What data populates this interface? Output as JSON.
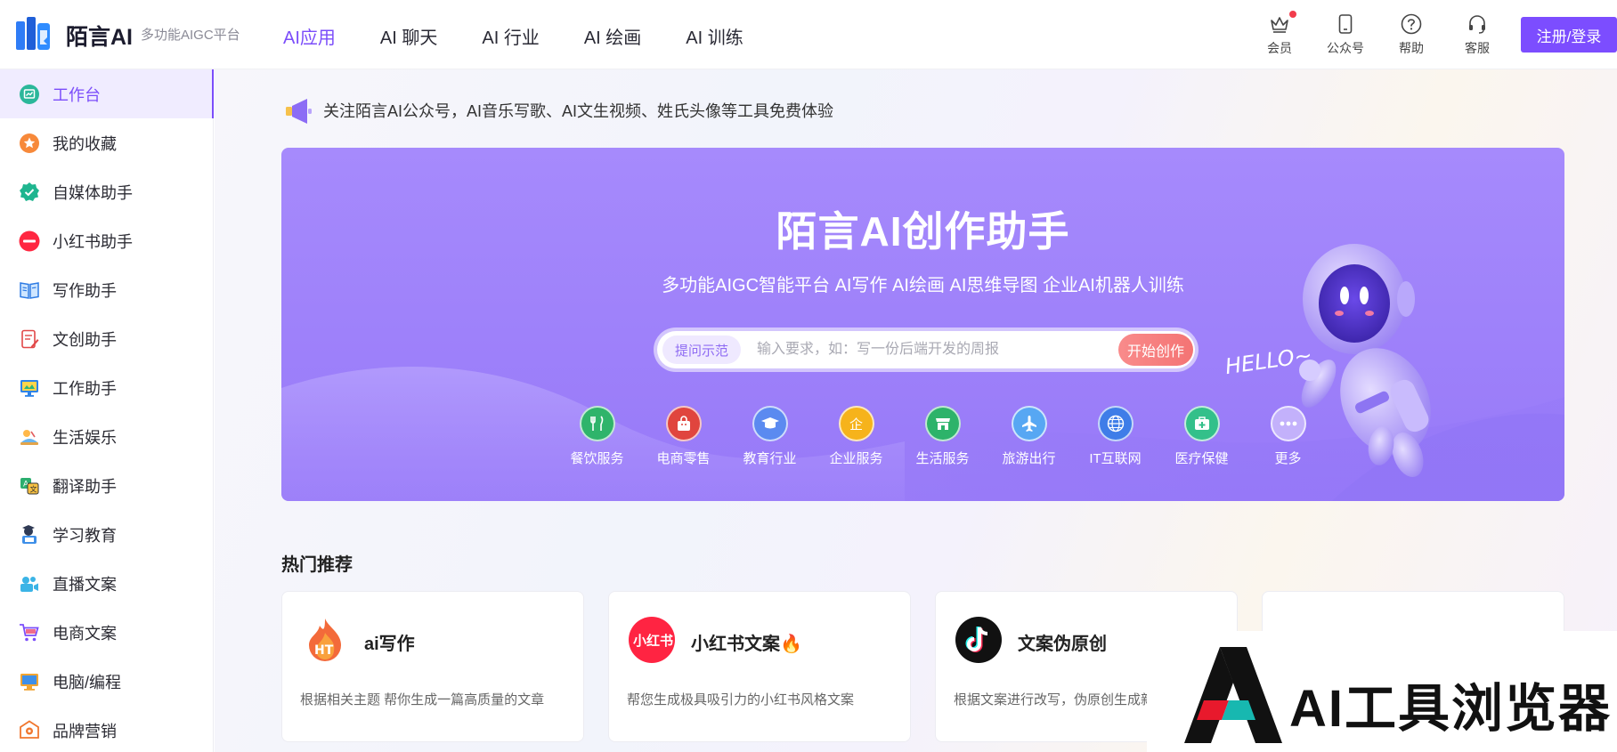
{
  "brand": {
    "name": "陌言AI",
    "tagline": "多功能AIGC平台"
  },
  "top_nav": [
    {
      "label": "AI应用",
      "active": true
    },
    {
      "label": "AI 聊天",
      "active": false
    },
    {
      "label": "AI 行业",
      "active": false
    },
    {
      "label": "AI 绘画",
      "active": false
    },
    {
      "label": "AI 训练",
      "active": false
    }
  ],
  "header_actions": {
    "member": "会员",
    "official_account": "公众号",
    "help": "帮助",
    "service": "客服",
    "login": "注册/登录"
  },
  "sidebar": [
    {
      "label": "工作台",
      "icon": "dashboard-icon",
      "active": true
    },
    {
      "label": "我的收藏",
      "icon": "star-icon"
    },
    {
      "label": "自媒体助手",
      "icon": "verified-icon"
    },
    {
      "label": "小红书助手",
      "icon": "xiaohongshu-icon"
    },
    {
      "label": "写作助手",
      "icon": "book-icon"
    },
    {
      "label": "文创助手",
      "icon": "doc-edit-icon"
    },
    {
      "label": "工作助手",
      "icon": "monitor-icon"
    },
    {
      "label": "生活娱乐",
      "icon": "leisure-icon"
    },
    {
      "label": "翻译助手",
      "icon": "translate-icon"
    },
    {
      "label": "学习教育",
      "icon": "student-icon"
    },
    {
      "label": "直播文案",
      "icon": "live-icon"
    },
    {
      "label": "电商文案",
      "icon": "cart-icon"
    },
    {
      "label": "电脑/编程",
      "icon": "computer-icon"
    },
    {
      "label": "品牌营销",
      "icon": "brand-icon"
    }
  ],
  "notice": {
    "text": "关注陌言AI公众号，AI音乐写歌、AI文生视频、姓氏头像等工具免费体验"
  },
  "hero": {
    "title": "陌言AI创作助手",
    "subtitle": "多功能AIGC智能平台 AI写作 AI绘画 AI思维导图 企业AI机器人训练",
    "example_tag": "提问示范",
    "search_placeholder": "输入要求，如：写一份后端开发的周报",
    "start_button": "开始创作",
    "hello_text": "HELLO~",
    "categories": [
      {
        "label": "餐饮服务",
        "icon": "utensils-icon",
        "color": "#2fb46b"
      },
      {
        "label": "电商零售",
        "icon": "shopping-bag-icon",
        "color": "#e0453e"
      },
      {
        "label": "教育行业",
        "icon": "graduation-cap-icon",
        "color": "#5b8af0"
      },
      {
        "label": "企业服务",
        "icon": "enterprise-icon",
        "color": "#f6b31b"
      },
      {
        "label": "生活服务",
        "icon": "store-icon",
        "color": "#2db36a"
      },
      {
        "label": "旅游出行",
        "icon": "plane-icon",
        "color": "#57a7f3"
      },
      {
        "label": "IT互联网",
        "icon": "globe-icon",
        "color": "#3f7de8"
      },
      {
        "label": "医疗保健",
        "icon": "medical-kit-icon",
        "color": "#33c08a"
      },
      {
        "label": "更多",
        "icon": "more-icon",
        "color": "#c3b1fb"
      }
    ]
  },
  "hot": {
    "title": "热门推荐",
    "cards": [
      {
        "title": "ai写作",
        "desc": "根据相关主题 帮你生成一篇高质量的文章",
        "icon": "ht-flame-icon"
      },
      {
        "title": "小红书文案🔥",
        "desc": "帮您生成极具吸引力的小红书风格文案",
        "icon": "xiaohongshu-logo-icon"
      },
      {
        "title": "文案伪原创",
        "desc": "根据文案进行改写，伪原创生成新",
        "icon": "tiktok-icon"
      },
      {
        "title": "",
        "desc": "",
        "icon": "purple-block-icon"
      }
    ]
  },
  "watermark": {
    "text": "AI工具浏览器"
  },
  "colors": {
    "accent": "#7b4dfa",
    "hero_bg": "#9d82fb",
    "start_button": "#f47474"
  }
}
